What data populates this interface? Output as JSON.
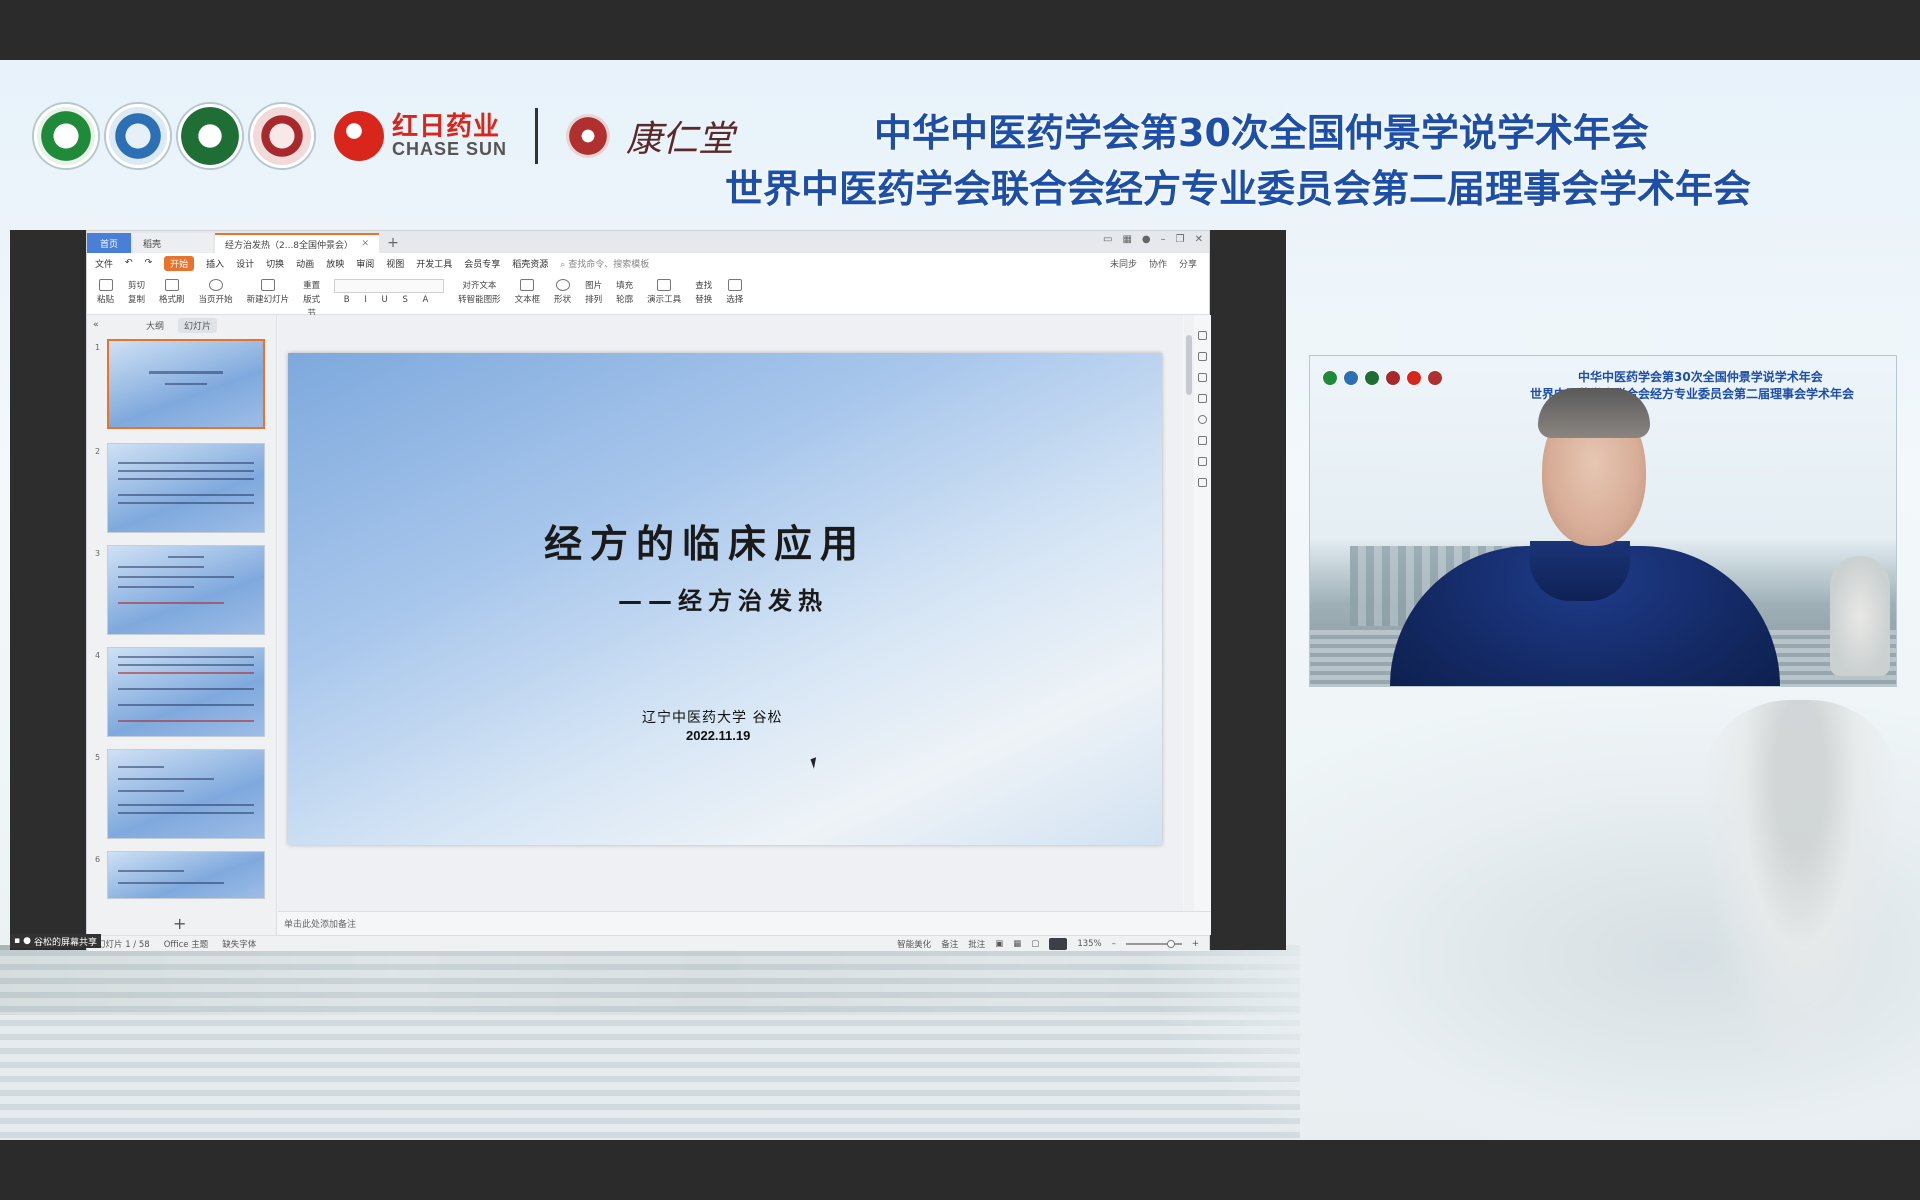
{
  "banner": {
    "brand_cn": "红日药业",
    "brand_en": "CHASE SUN",
    "brand2": "康仁堂",
    "title_line1": "中华中医药学会第30次全国仲景学说学术年会",
    "title_line2": "世界中医药学会联合会经方专业委员会第二届理事会学术年会"
  },
  "wps": {
    "tabs": {
      "home": "首页",
      "draft": "稻壳",
      "doc": "经方治发热（2...8全国仲景会）",
      "add": "+"
    },
    "menu": {
      "file": "文件",
      "items": [
        "开始",
        "插入",
        "设计",
        "切换",
        "动画",
        "放映",
        "审阅",
        "视图",
        "开发工具",
        "会员专享",
        "稻壳资源"
      ],
      "search": "查找命令、搜索模板",
      "right": [
        "未同步",
        "协作",
        "分享"
      ]
    },
    "ribbon": {
      "paste": "粘贴",
      "cut": "剪切",
      "copy": "复制",
      "format_painter": "格式刷",
      "play_from_current": "当页开始",
      "new_slide": "新建幻灯片",
      "layout": "版式",
      "section": "节",
      "reset": "重置",
      "align_text": "对齐文本",
      "smartart": "转智能图形",
      "textbox": "文本框",
      "shape": "形状",
      "picture": "图片",
      "arrange": "排列",
      "fill": "填充",
      "outline": "轮廓",
      "present_tools": "演示工具",
      "find": "查找",
      "replace": "替换",
      "select": "选择"
    },
    "panel": {
      "outline": "大纲",
      "slides": "幻灯片",
      "thumb_numbers": [
        "1",
        "2",
        "3",
        "4",
        "5",
        "6"
      ],
      "add": "+"
    },
    "slide": {
      "title": "经方的临床应用",
      "subtitle": "——经方治发热",
      "author": "辽宁中医药大学    谷松",
      "date": "2022.11.19"
    },
    "notes_placeholder": "单击此处添加备注",
    "status": {
      "slide_count": "幻灯片 1 / 58",
      "theme": "Office 主题",
      "missing_font": "缺失字体",
      "smart_beautify": "智能美化",
      "notes": "备注",
      "comments": "批注",
      "zoom": "135%",
      "zoom_fraction": 0.8
    }
  },
  "screen_share_label": "谷松的屏幕共享",
  "video": {
    "title_line1": "中华中医药学会第30次全国仲景学说学术年会",
    "title_line2": "世界中医药学会联合会经方专业委员会第二届理事会学术年会"
  },
  "colors": {
    "banner_title": "#1d4ea8",
    "brand_red": "#d9261c",
    "wps_accent": "#e8732c",
    "home_tab": "#4a7fd8"
  }
}
